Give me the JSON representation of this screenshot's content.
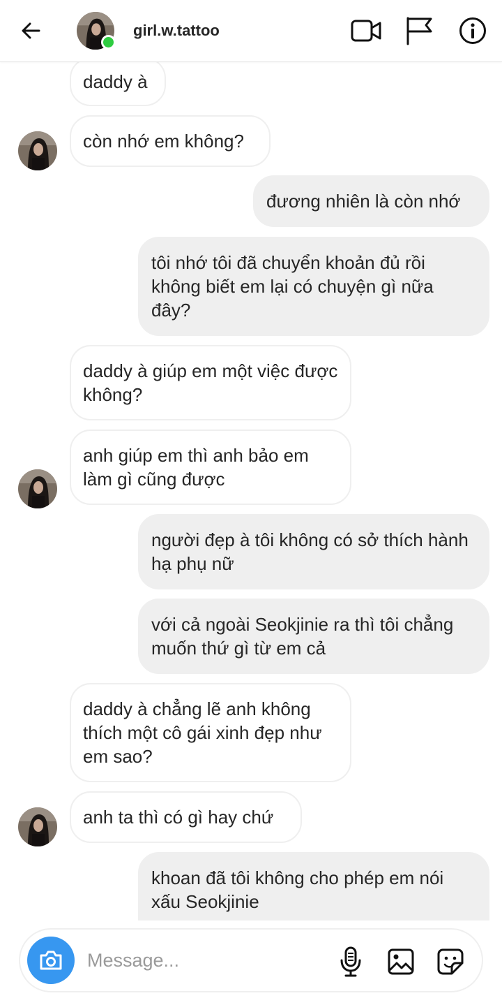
{
  "header": {
    "username": "girl.w.tattoo",
    "status": "online",
    "icons": [
      "back-arrow-icon",
      "video-call-icon",
      "flag-icon",
      "info-icon"
    ]
  },
  "messages": [
    {
      "side": "in",
      "text": "daddy à"
    },
    {
      "side": "in",
      "text": "còn nhớ em không?"
    },
    {
      "side": "out",
      "text": "đương nhiên là còn nhớ"
    },
    {
      "side": "out",
      "text": "tôi nhớ tôi đã chuyển khoản đủ rồi không biết em lại có chuyện gì nữa đây?"
    },
    {
      "side": "in",
      "text": "daddy à giúp em một việc được không?"
    },
    {
      "side": "in",
      "text": "anh giúp em thì anh bảo em làm gì cũng được"
    },
    {
      "side": "out",
      "text": "người đẹp à tôi không có sở thích hành hạ phụ nữ"
    },
    {
      "side": "out",
      "text": "với cả ngoài Seokjinie ra thì tôi chẳng muốn thứ gì từ em cả"
    },
    {
      "side": "in",
      "text": "daddy à chẳng lẽ anh không thích một cô gái xinh đẹp như em sao?"
    },
    {
      "side": "in",
      "text": "anh ta thì có gì hay chứ"
    },
    {
      "side": "out",
      "text": "khoan đã tôi không cho phép em nói xấu Seokjinie"
    }
  ],
  "composer": {
    "placeholder": "Message...",
    "icons": [
      "camera-icon",
      "microphone-icon",
      "gallery-icon",
      "sticker-icon"
    ]
  },
  "colors": {
    "incoming_bubble": "#ffffff",
    "outgoing_bubble": "#efefef",
    "camera_button": "#3797f0",
    "online_dot": "#2ecc40",
    "text": "#262626"
  }
}
